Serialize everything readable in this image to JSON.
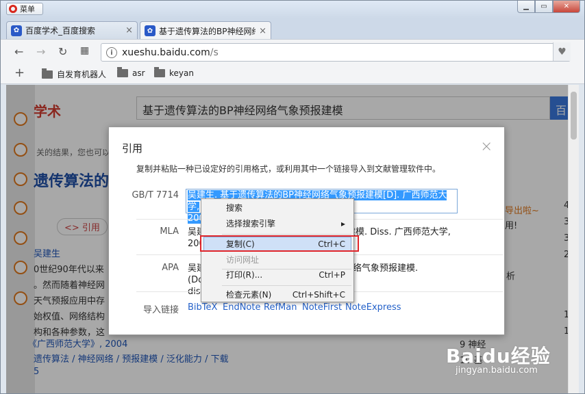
{
  "window": {
    "menu_label": "菜单"
  },
  "tabs": [
    {
      "label": "百度学术_百度搜索",
      "active": false
    },
    {
      "label": "基于遗传算法的BP神经网络",
      "active": true
    }
  ],
  "address": {
    "domain": "xueshu.baidu.com",
    "path": "/s"
  },
  "bookmarks": [
    "自发育机器人",
    "asr",
    "keyan"
  ],
  "background_page": {
    "logo": "学术",
    "search_query": "基于遗传算法的BP神经网络气象预报建模",
    "search_button": "百",
    "related_hint": "关的结果，您也可以",
    "big_title": "遗传算法的",
    "cite_button": "<> 引用",
    "author": "吴建生",
    "abstract_lines": [
      "0世纪90年代以来",
      "。然而随着神经网",
      "天气预报应用中存",
      "始权值、网络结构",
      "构和各种参数，这"
    ],
    "source": "《广西师范大学》, 2004",
    "keywords": "遗传算法 / 神经网络 / 预报建模 / 泛化能力 / 下载",
    "page_num": "5",
    "right_bubble": [
      "导出啦~",
      "用!"
    ],
    "right_text": [
      "析",
      "9  神经",
      "10  基"
    ],
    "right_nums": [
      "4",
      "3",
      "3",
      "2",
      "1",
      "1"
    ]
  },
  "dialog": {
    "title": "引用",
    "close": "×",
    "description": "复制并粘贴一种已设定好的引用格式，或利用其中一个链接导入到文献管理软件中。",
    "citations": [
      {
        "style": "GB/T 7714",
        "line1": "吴建生. 基于遗传算法的BP神经网络气象预报建模[D]. 广西师范大学,",
        "line2": "2004."
      },
      {
        "style": "MLA",
        "line1_a": "吴建",
        "line1_b": "预报建模. Diss. 广西师范大学,",
        "line2": "200"
      },
      {
        "style": "APA",
        "line1_a": "吴建",
        "line1_b": "络气象预报建模. (Doctoral",
        "line2": "diss"
      }
    ],
    "import_label": "导入链接",
    "import_links": [
      "BibTeX",
      "EndNote",
      "RefMan",
      "NoteFirst",
      "NoteExpress"
    ]
  },
  "context_menu": {
    "items": [
      {
        "label": "搜索",
        "shortcut": "",
        "disabled": false
      },
      {
        "label": "选择搜索引擎",
        "shortcut": "▸",
        "disabled": false
      },
      {
        "label": "复制(C)",
        "shortcut": "Ctrl+C",
        "disabled": false
      },
      {
        "label": "访问网址",
        "shortcut": "",
        "disabled": true
      },
      {
        "label": "打印(R)...",
        "shortcut": "Ctrl+P",
        "disabled": false
      },
      {
        "label": "检查元素(N)",
        "shortcut": "Ctrl+Shift+C",
        "disabled": false
      }
    ]
  },
  "watermark": {
    "brand": "Baidu经验",
    "url": "jingyan.baidu.com"
  },
  "colors": {
    "highlight": "#3399ff",
    "red_box": "#e0252a",
    "link": "#2461c9"
  }
}
